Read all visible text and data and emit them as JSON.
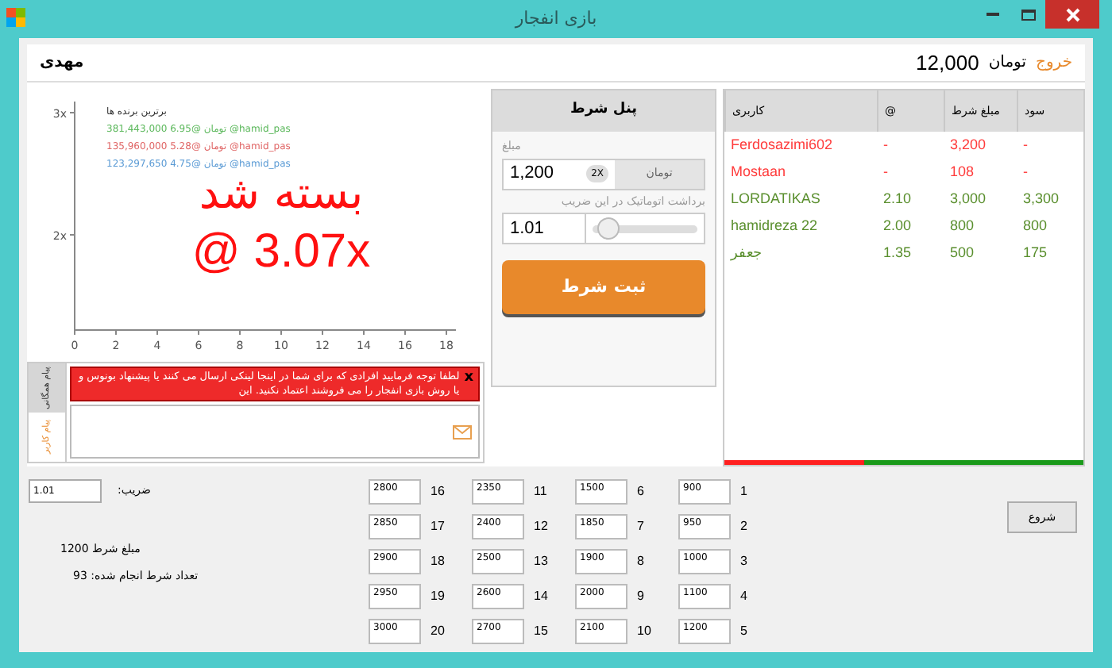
{
  "window": {
    "title": "بازی انفجار"
  },
  "header": {
    "exit": "خروج",
    "currency": "تومان",
    "balance": "12,000",
    "username": "مهدی"
  },
  "chart": {
    "y_ticks": [
      "3x",
      "2x"
    ],
    "x_ticks": [
      "18",
      "16",
      "14",
      "12",
      "10",
      "8",
      "6",
      "4",
      "2",
      "0"
    ],
    "top_title": "برترین برنده ها",
    "top_winners": [
      {
        "text": "381,443,000 6.95@ تومان @hamid_pas",
        "color": "#5cb85c"
      },
      {
        "text": "135,960,000 5.28@ تومان @hamid_pas",
        "color": "#e06666"
      },
      {
        "text": "123,297,650 4.75@ تومان @hamid_pas",
        "color": "#5b9bd5"
      }
    ],
    "status": "بسته شد",
    "multiplier": "@ 3.07x"
  },
  "chat": {
    "tabs": [
      {
        "label": "پیام همگانی",
        "selected": false
      },
      {
        "label": "پیام کاربر",
        "selected": true
      }
    ],
    "alert": "لطفا توجه فرمایید افرادی که برای شما در اینجا لینکی ارسال می کنند یا پیشنهاد بونوس و یا روش بازی انفجار را می فروشند اعتماد نکنید. این",
    "alert_close": "x"
  },
  "bet_panel": {
    "title": "پنل شرط",
    "amount_label": "مبلغ",
    "amount": "1,200",
    "double": "2X",
    "currency": "تومان",
    "auto_label": "برداشت اتوماتیک در این ضریب",
    "auto_value": "1.01",
    "auto_slider": {
      "level": 0.05
    },
    "submit": "ثبت شرط"
  },
  "table": {
    "columns": [
      "سود",
      "مبلغ شرط",
      "@",
      "کاربری"
    ],
    "rows": [
      {
        "cells": [
          "-",
          "3,200",
          "-",
          "Ferdosazimi602"
        ],
        "color": "#ff3b3b"
      },
      {
        "cells": [
          "-",
          "108",
          "-",
          "Mostaan"
        ],
        "color": "#ff3b3b"
      },
      {
        "cells": [
          "3,300",
          "3,000",
          "2.10",
          "LORDATIKAS"
        ],
        "color": "#5a8f2e"
      },
      {
        "cells": [
          "800",
          "800",
          "2.00",
          "hamidreza 22"
        ],
        "color": "#5a8f2e"
      },
      {
        "cells": [
          "175",
          "500",
          "1.35",
          "جعفر"
        ],
        "color": "#5a8f2e"
      }
    ],
    "balance_bar": {
      "level": 0.39
    }
  },
  "settings": {
    "multiplier_label": "ضریب:",
    "multiplier": "1.01",
    "bet_amount": "مبلغ شرط 1200",
    "bet_count": "تعداد شرط انجام شده: 93",
    "start": "شروع",
    "fields": [
      {
        "label": "1",
        "value": "900"
      },
      {
        "label": "2",
        "value": "950"
      },
      {
        "label": "3",
        "value": "1000"
      },
      {
        "label": "4",
        "value": "1100"
      },
      {
        "label": "5",
        "value": "1200"
      },
      {
        "label": "6",
        "value": "1500"
      },
      {
        "label": "7",
        "value": "1850"
      },
      {
        "label": "8",
        "value": "1900"
      },
      {
        "label": "9",
        "value": "2000"
      },
      {
        "label": "10",
        "value": "2100"
      },
      {
        "label": "11",
        "value": "2350"
      },
      {
        "label": "12",
        "value": "2400"
      },
      {
        "label": "13",
        "value": "2500"
      },
      {
        "label": "14",
        "value": "2600"
      },
      {
        "label": "15",
        "value": "2700"
      },
      {
        "label": "16",
        "value": "2800"
      },
      {
        "label": "17",
        "value": "2850"
      },
      {
        "label": "18",
        "value": "2900"
      },
      {
        "label": "19",
        "value": "2950"
      },
      {
        "label": "20",
        "value": "3000"
      }
    ]
  }
}
